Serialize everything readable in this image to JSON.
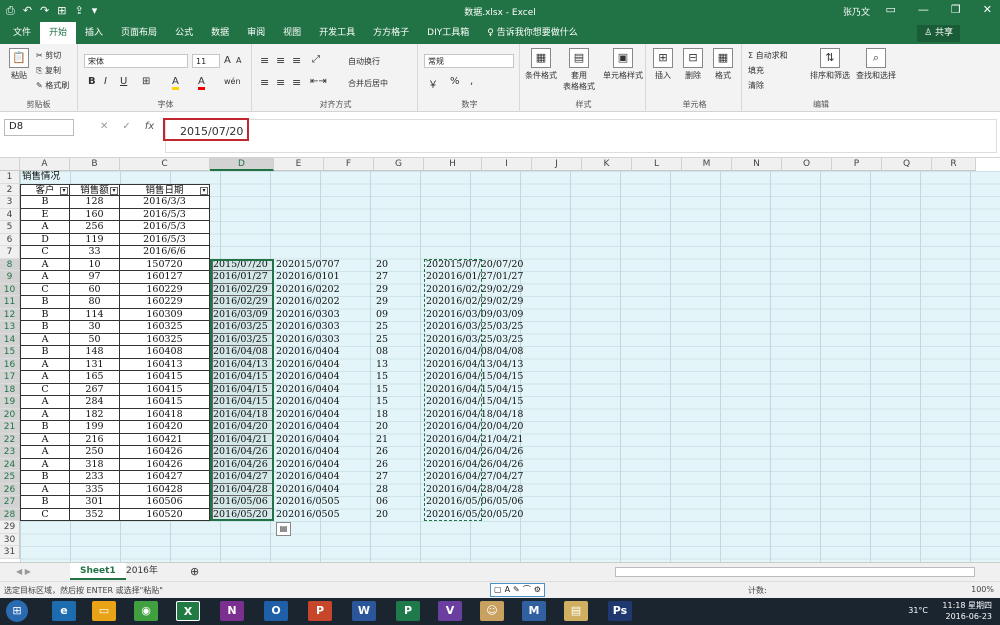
{
  "window": {
    "title": "数据.xlsx - Excel",
    "user": "张乃文",
    "controls": [
      "▭",
      "—",
      "❐",
      "✕"
    ]
  },
  "qat": [
    "⎙",
    "↶",
    "↷",
    "⊞",
    "⇪",
    "▾"
  ],
  "tabs": [
    "文件",
    "开始",
    "插入",
    "页面布局",
    "公式",
    "数据",
    "审阅",
    "视图",
    "开发工具",
    "方方格子",
    "DIY工具箱",
    "♀ 告诉我你想要做什么"
  ],
  "share": "♙ 共享",
  "ribbon": {
    "clipboard": {
      "label": "剪贴板",
      "paste": "粘贴",
      "cut": "✂ 剪切",
      "copy": "⎘ 复制",
      "painter": "✎ 格式刷"
    },
    "font": {
      "label": "字体",
      "name": "宋体",
      "size": "11",
      "bold": "B",
      "italic": "I",
      "underline": "U",
      "grow": "A",
      "shrink": "A",
      "border": "⊞",
      "fill": "A",
      "color": "A",
      "wen": "wén"
    },
    "align": {
      "label": "对齐方式",
      "wrap": "自动换行",
      "merge": "合并后居中"
    },
    "number": {
      "label": "数字",
      "format": "常规",
      "percent": "%",
      "comma": ","
    },
    "styles": {
      "label": "样式",
      "cond": "条件格式",
      "table": "套用\n表格格式",
      "cell": "单元格样式"
    },
    "cells": {
      "label": "单元格",
      "insert": "插入",
      "delete": "删除",
      "format": "格式"
    },
    "edit": {
      "label": "编辑",
      "autosum": "Σ 自动求和",
      "fill": "填充",
      "clear": "清除",
      "sort": "排序和筛选",
      "find": "查找和选择"
    }
  },
  "formula": {
    "namebox": "D8",
    "value": "2015/07/20",
    "cancel": "✕",
    "enter": "✓",
    "fx": "fx"
  },
  "columns": [
    "A",
    "B",
    "C",
    "D",
    "E",
    "F",
    "G",
    "H",
    "I",
    "J",
    "K",
    "L",
    "M",
    "N",
    "O",
    "P",
    "Q",
    "R"
  ],
  "rows": [
    "1",
    "2",
    "3",
    "4",
    "5",
    "6",
    "7",
    "8",
    "9",
    "10",
    "11",
    "12",
    "13",
    "14",
    "15",
    "16",
    "17",
    "18",
    "19",
    "20",
    "21",
    "22",
    "23",
    "24",
    "25",
    "26",
    "27",
    "28",
    "29",
    "30",
    "31"
  ],
  "sheet": {
    "title": "销售情况",
    "headers": [
      "客户",
      "销售额",
      "销售日期"
    ],
    "data": [
      [
        "B",
        "128",
        "2016/3/3",
        "",
        "",
        "",
        ""
      ],
      [
        "E",
        "160",
        "2016/5/3",
        "",
        "",
        "",
        ""
      ],
      [
        "A",
        "256",
        "2016/5/3",
        "",
        "",
        "",
        ""
      ],
      [
        "D",
        "119",
        "2016/5/3",
        "",
        "",
        "",
        ""
      ],
      [
        "C",
        "33",
        "2016/6/6",
        "",
        "",
        "",
        ""
      ],
      [
        "A",
        "10",
        "150720",
        "2015/07/20",
        "202015/0707",
        "20",
        "202015/07/20/07/20"
      ],
      [
        "A",
        "97",
        "160127",
        "2016/01/27",
        "202016/0101",
        "27",
        "202016/01/27/01/27"
      ],
      [
        "C",
        "60",
        "160229",
        "2016/02/29",
        "202016/0202",
        "29",
        "202016/02/29/02/29"
      ],
      [
        "B",
        "80",
        "160229",
        "2016/02/29",
        "202016/0202",
        "29",
        "202016/02/29/02/29"
      ],
      [
        "B",
        "114",
        "160309",
        "2016/03/09",
        "202016/0303",
        "09",
        "202016/03/09/03/09"
      ],
      [
        "B",
        "30",
        "160325",
        "2016/03/25",
        "202016/0303",
        "25",
        "202016/03/25/03/25"
      ],
      [
        "A",
        "50",
        "160325",
        "2016/03/25",
        "202016/0303",
        "25",
        "202016/03/25/03/25"
      ],
      [
        "B",
        "148",
        "160408",
        "2016/04/08",
        "202016/0404",
        "08",
        "202016/04/08/04/08"
      ],
      [
        "A",
        "131",
        "160413",
        "2016/04/13",
        "202016/0404",
        "13",
        "202016/04/13/04/13"
      ],
      [
        "A",
        "165",
        "160415",
        "2016/04/15",
        "202016/0404",
        "15",
        "202016/04/15/04/15"
      ],
      [
        "C",
        "267",
        "160415",
        "2016/04/15",
        "202016/0404",
        "15",
        "202016/04/15/04/15"
      ],
      [
        "A",
        "284",
        "160415",
        "2016/04/15",
        "202016/0404",
        "15",
        "202016/04/15/04/15"
      ],
      [
        "A",
        "182",
        "160418",
        "2016/04/18",
        "202016/0404",
        "18",
        "202016/04/18/04/18"
      ],
      [
        "B",
        "199",
        "160420",
        "2016/04/20",
        "202016/0404",
        "20",
        "202016/04/20/04/20"
      ],
      [
        "A",
        "216",
        "160421",
        "2016/04/21",
        "202016/0404",
        "21",
        "202016/04/21/04/21"
      ],
      [
        "A",
        "250",
        "160426",
        "2016/04/26",
        "202016/0404",
        "26",
        "202016/04/26/04/26"
      ],
      [
        "A",
        "318",
        "160426",
        "2016/04/26",
        "202016/0404",
        "26",
        "202016/04/26/04/26"
      ],
      [
        "B",
        "233",
        "160427",
        "2016/04/27",
        "202016/0404",
        "27",
        "202016/04/27/04/27"
      ],
      [
        "A",
        "335",
        "160428",
        "2016/04/28",
        "202016/0404",
        "28",
        "202016/04/28/04/28"
      ],
      [
        "B",
        "301",
        "160506",
        "2016/05/06",
        "202016/0505",
        "06",
        "202016/05/06/05/06"
      ],
      [
        "C",
        "352",
        "160520",
        "2016/05/20",
        "202016/0505",
        "20",
        "202016/05/20/05/20"
      ]
    ]
  },
  "sheets": [
    "Sheet1",
    "2016年"
  ],
  "status": "选定目标区域，然后按 ENTER 或选择\"粘贴\"",
  "statusRight": "计数:",
  "zoom": "100%",
  "taskbar": {
    "time": "11:18 星期四",
    "date": "2016-06-23",
    "weather": "31°C"
  },
  "colors": {
    "accent": "#217346",
    "selection": "#c0262d"
  }
}
